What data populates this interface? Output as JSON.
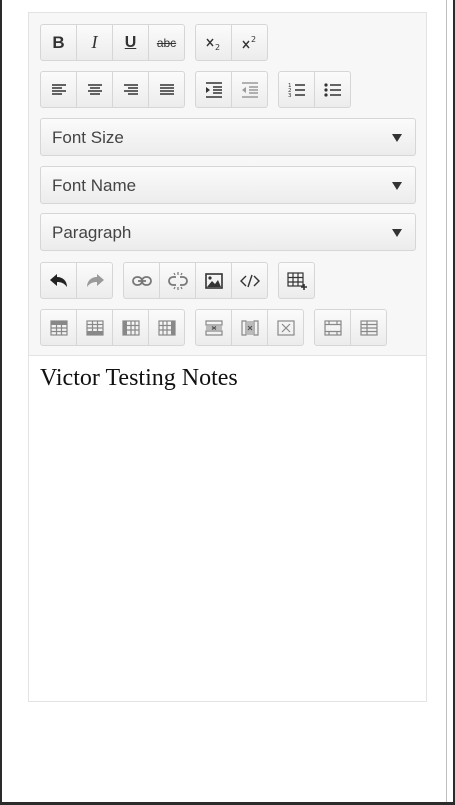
{
  "toolbar": {
    "format_buttons": {
      "bold": "B",
      "italic": "I",
      "underline": "U",
      "strikethrough": "abc"
    },
    "font_size": {
      "selected": "Font Size"
    },
    "font_name": {
      "selected": "Font Name"
    },
    "block_format": {
      "selected": "Paragraph"
    }
  },
  "content": {
    "text": "Victor Testing Notes"
  },
  "icons": [
    "bold-icon",
    "italic-icon",
    "underline-icon",
    "strikethrough-icon",
    "subscript-icon",
    "superscript-icon",
    "align-left-icon",
    "align-center-icon",
    "align-right-icon",
    "justify-icon",
    "indent-icon",
    "outdent-icon",
    "ordered-list-icon",
    "unordered-list-icon",
    "undo-icon",
    "redo-icon",
    "link-icon",
    "unlink-icon",
    "image-icon",
    "code-icon",
    "insert-table-icon",
    "insert-row-above-icon",
    "insert-row-below-icon",
    "insert-column-left-icon",
    "insert-column-right-icon",
    "delete-row-icon",
    "delete-column-icon",
    "delete-table-icon",
    "merge-cells-icon",
    "split-cells-icon"
  ]
}
